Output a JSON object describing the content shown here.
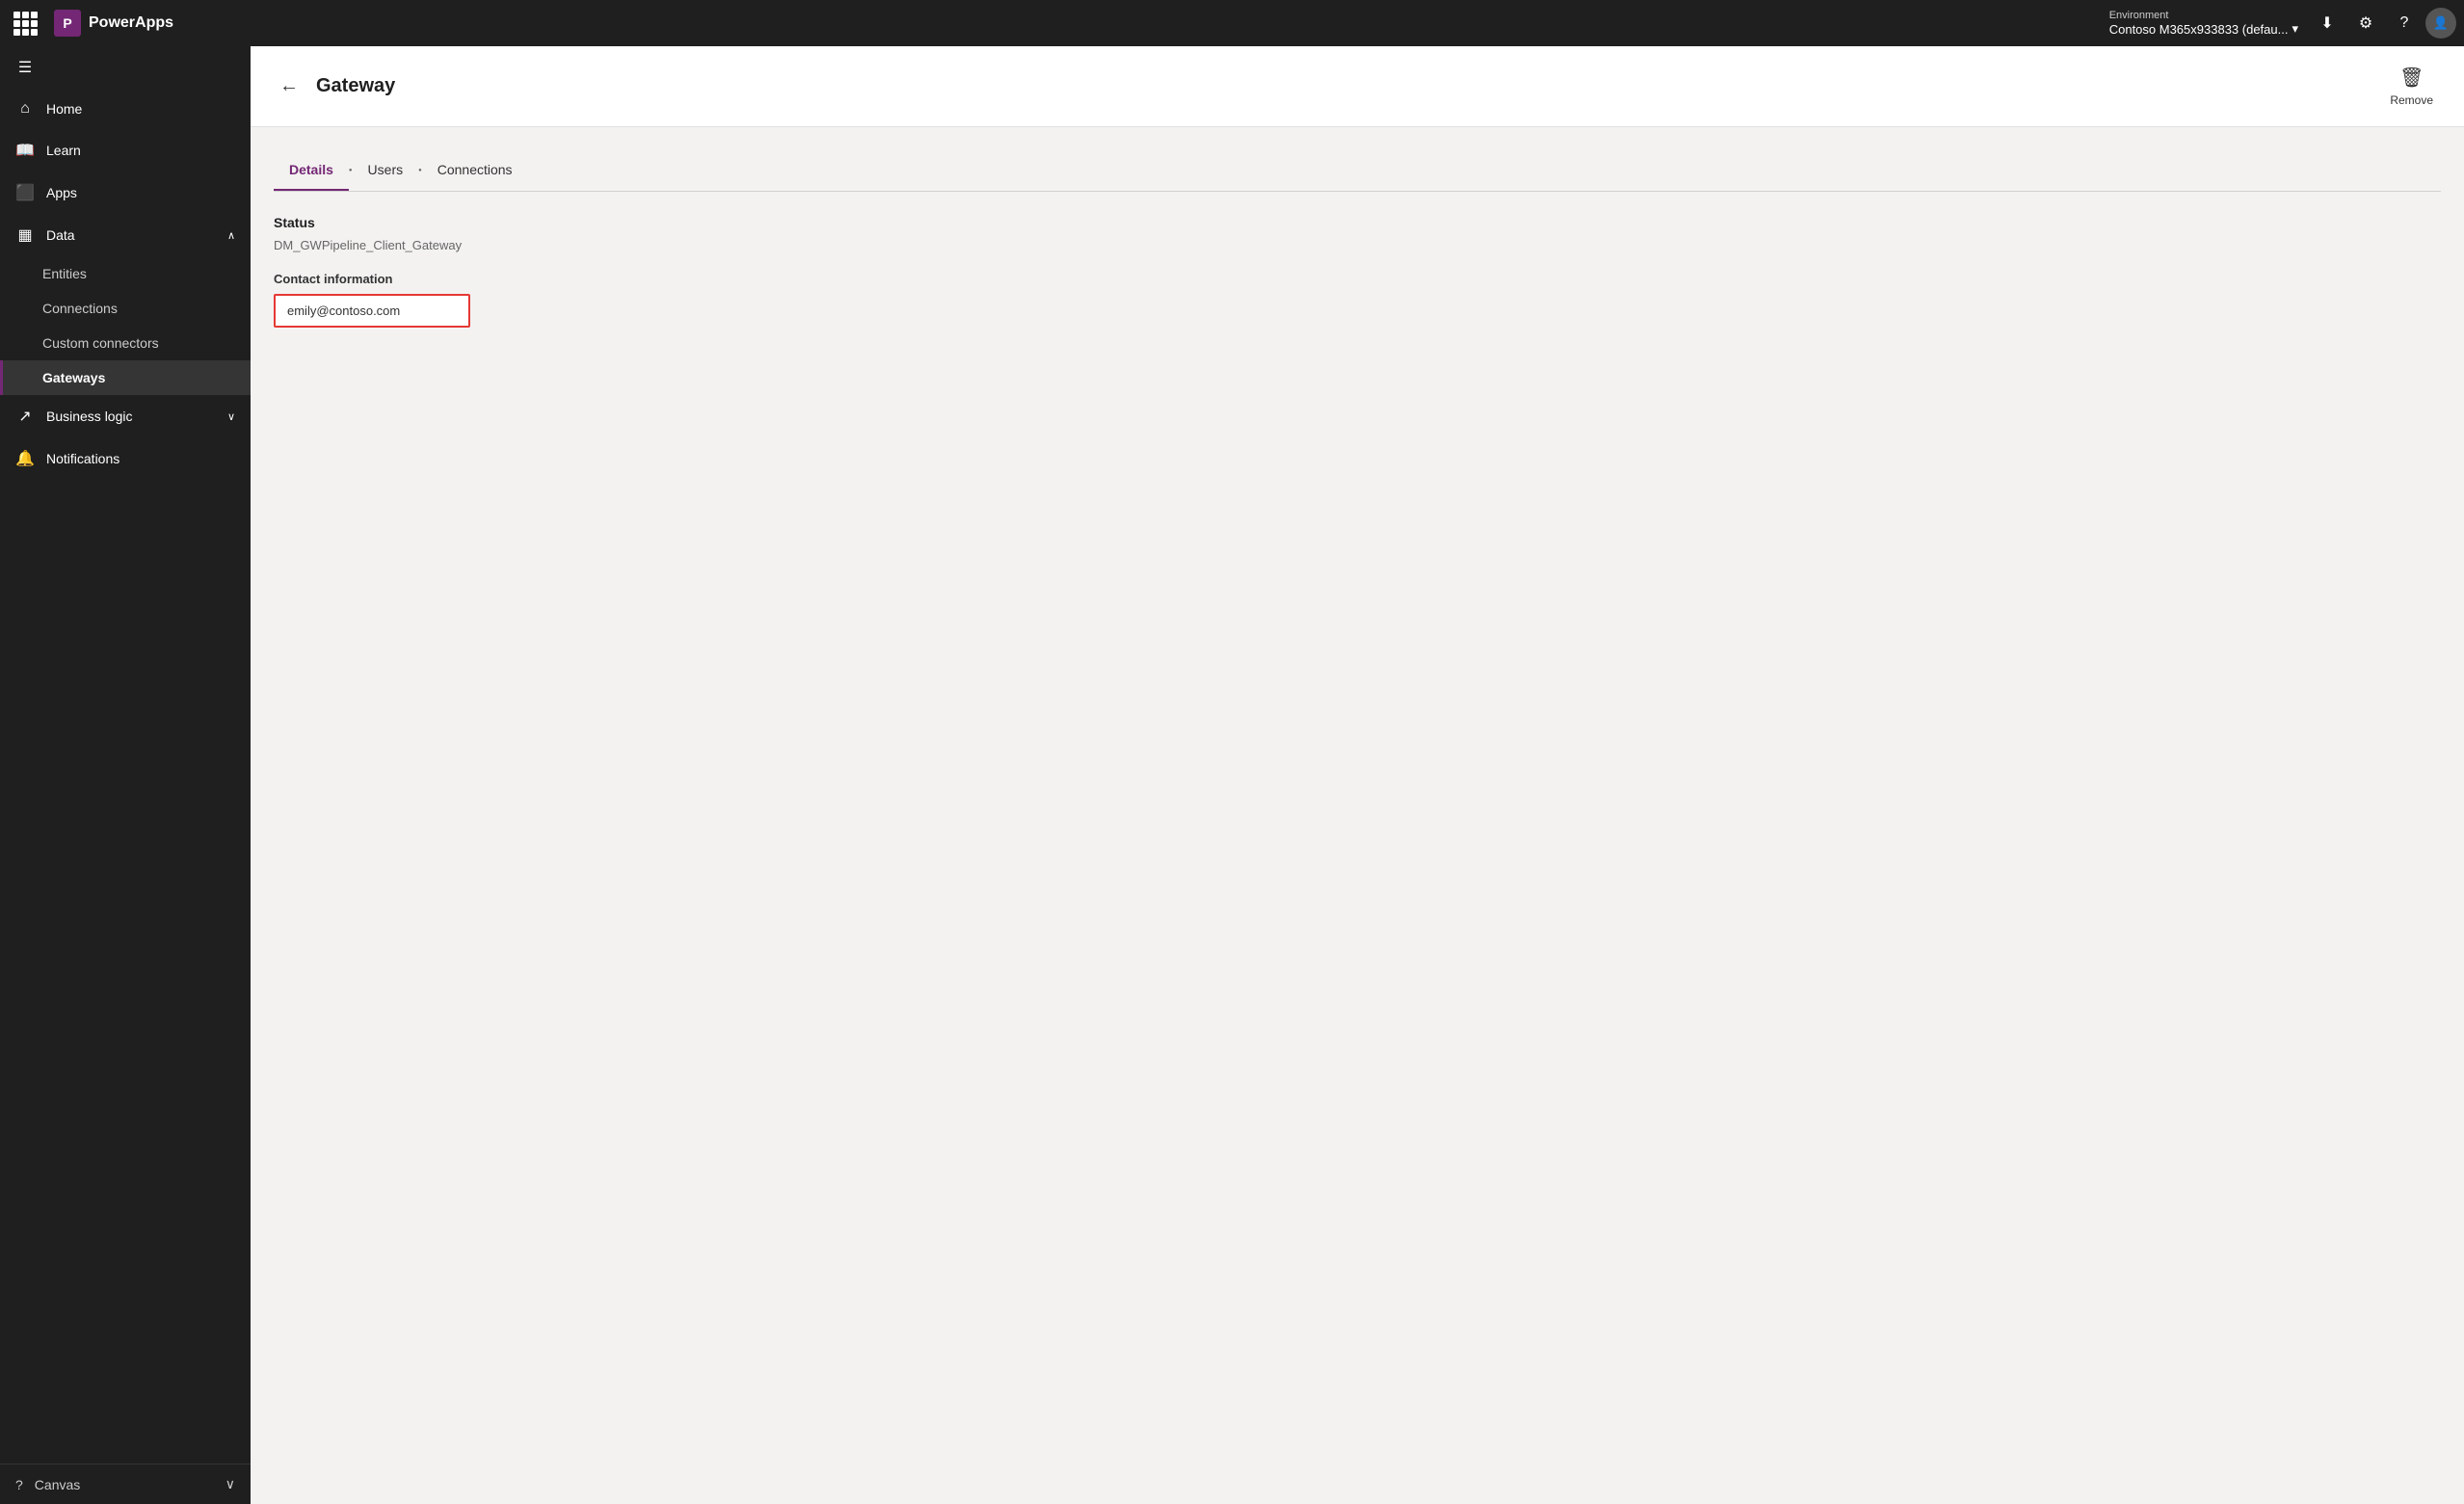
{
  "topbar": {
    "app_name": "PowerApps",
    "environment_label": "Environment",
    "environment_name": "Contoso M365x933833 (defau...",
    "download_icon": "⬇",
    "settings_icon": "⚙",
    "help_icon": "?",
    "avatar_initials": ""
  },
  "sidebar": {
    "hamburger_label": "☰",
    "items": [
      {
        "id": "home",
        "label": "Home",
        "icon": "🏠",
        "active": false
      },
      {
        "id": "learn",
        "label": "Learn",
        "icon": "📖",
        "active": false
      },
      {
        "id": "apps",
        "label": "Apps",
        "icon": "⬜",
        "active": false
      },
      {
        "id": "data",
        "label": "Data",
        "icon": "📊",
        "active": false,
        "expanded": true,
        "chevron": "∧"
      }
    ],
    "sub_items": [
      {
        "id": "entities",
        "label": "Entities",
        "active": false
      },
      {
        "id": "connections",
        "label": "Connections",
        "active": false
      },
      {
        "id": "custom-connectors",
        "label": "Custom connectors",
        "active": false
      },
      {
        "id": "gateways",
        "label": "Gateways",
        "active": true
      }
    ],
    "bottom_items": [
      {
        "id": "business-logic",
        "label": "Business logic",
        "icon": "↗",
        "active": false,
        "chevron": "∨"
      },
      {
        "id": "notifications",
        "label": "Notifications",
        "icon": "🔔",
        "active": false
      }
    ],
    "footer": {
      "label": "Canvas",
      "icon": "?",
      "chevron": "∨"
    }
  },
  "page": {
    "title": "Gateway",
    "back_label": "←",
    "remove_label": "Remove",
    "tabs": [
      {
        "id": "details",
        "label": "Details",
        "active": true
      },
      {
        "id": "users",
        "label": "Users",
        "active": false
      },
      {
        "id": "connections",
        "label": "Connections",
        "active": false
      }
    ],
    "status_label": "Status",
    "gateway_name": "DM_GWPipeline_Client_Gateway",
    "contact_info_label": "Contact information",
    "contact_email": "emily@contoso.com"
  }
}
